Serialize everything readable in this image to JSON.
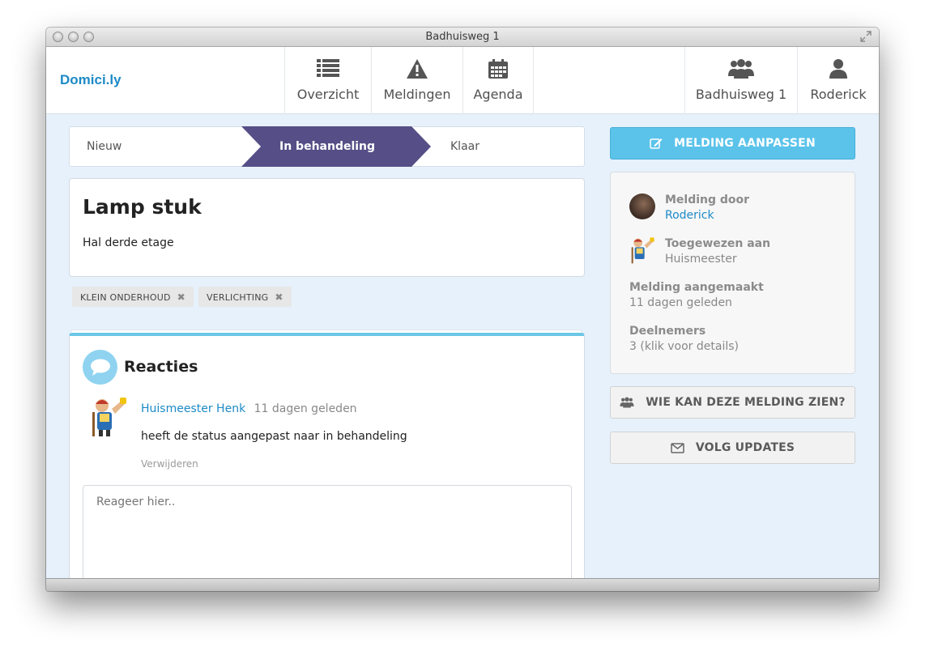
{
  "window": {
    "title": "Badhuisweg 1"
  },
  "brand": "Domici.ly",
  "nav": {
    "left": [
      {
        "label": "Overzicht",
        "icon": "list-icon"
      },
      {
        "label": "Meldingen",
        "icon": "warning-icon"
      },
      {
        "label": "Agenda",
        "icon": "calendar-icon"
      }
    ],
    "right": [
      {
        "label": "Badhuisweg 1",
        "icon": "group-icon"
      },
      {
        "label": "Roderick",
        "icon": "user-icon"
      }
    ]
  },
  "steps": {
    "new": "Nieuw",
    "active": "In behandeling",
    "done": "Klaar",
    "active_color": "#564e86"
  },
  "issue": {
    "title": "Lamp stuk",
    "description": "Hal derde etage"
  },
  "tags": [
    "KLEIN ONDERHOUD",
    "VERLICHTING"
  ],
  "comments": {
    "heading": "Reacties",
    "items": [
      {
        "author": "Huismeester Henk",
        "time": "11 dagen geleden",
        "text": "heeft de status aangepast naar in behandeling",
        "delete_label": "Verwijderen"
      }
    ],
    "reply_placeholder": "Reageer hier.."
  },
  "sidebar": {
    "edit_button": "MELDING AANPASSEN",
    "reported_by_label": "Melding door",
    "reported_by_value": "Roderick",
    "assigned_label": "Toegewezen aan",
    "assigned_value": "Huismeester",
    "created_label": "Melding aangemaakt",
    "created_value": "11 dagen geleden",
    "participants_label": "Deelnemers",
    "participants_value": "3 (klik voor details)",
    "who_can_see_button": "WIE KAN DEZE MELDING ZIEN?",
    "follow_button": "VOLG UPDATES"
  },
  "colors": {
    "accent": "#1d8ac6",
    "primary_button": "#5bc3ea",
    "background": "#e6f1fb"
  }
}
